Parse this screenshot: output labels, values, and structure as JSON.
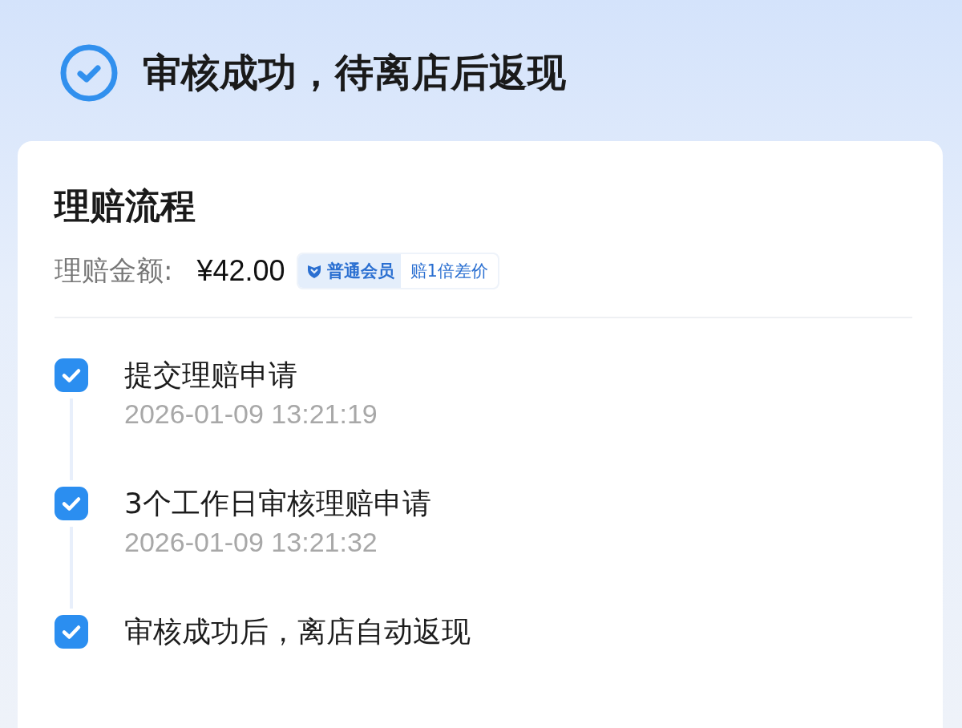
{
  "header": {
    "title": "审核成功，待离店后返现"
  },
  "card": {
    "title": "理赔流程",
    "amount_label": "理赔金额:",
    "amount": "¥42.00",
    "badge": {
      "level_name": "普通会员",
      "benefit": "赔1倍差价"
    },
    "steps": [
      {
        "title": "提交理赔申请",
        "time": "2026-01-09 13:21:19",
        "checked": true
      },
      {
        "title": "3个工作日审核理赔申请",
        "time": "2026-01-09 13:21:32",
        "checked": true
      },
      {
        "title": "审核成功后，离店自动返现",
        "checked": true
      }
    ]
  }
}
